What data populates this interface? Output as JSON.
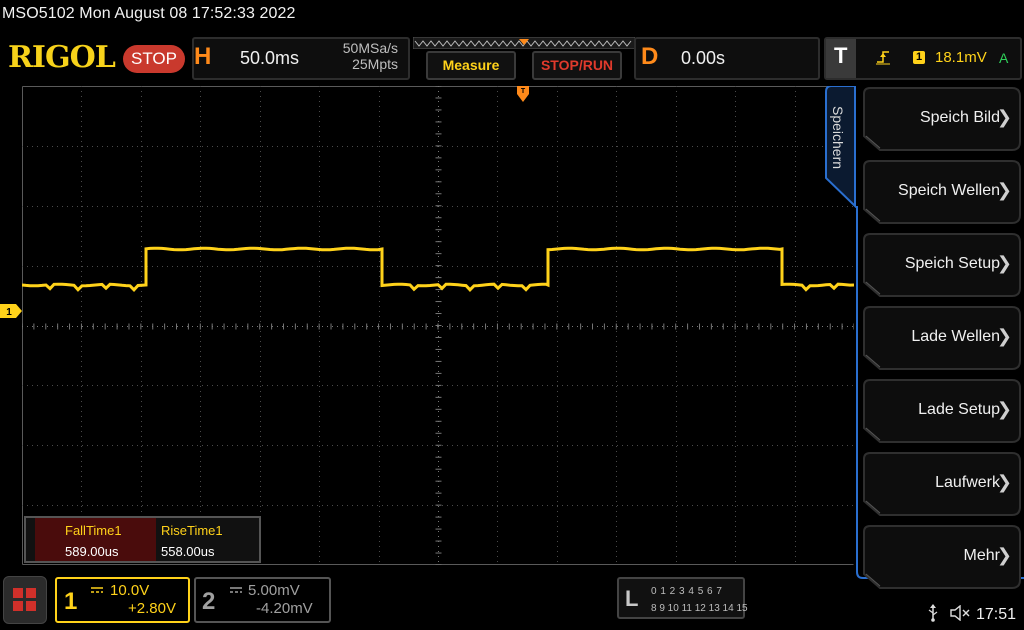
{
  "top_info": "MSO5102  Mon August 08 17:52:33 2022",
  "brand": {
    "logo_text": "RIGOL",
    "run_state": "STOP"
  },
  "horizontal": {
    "letter": "H",
    "timebase": "50.0ms",
    "sample_rate": "50MSa/s",
    "memory_depth": "25Mpts"
  },
  "toolbar": {
    "measure_label": "Measure",
    "stop_run_label": "STOP/RUN"
  },
  "delay": {
    "letter": "D",
    "value": "0.00s"
  },
  "trigger": {
    "letter": "T",
    "edge_icon": "rising-edge-icon",
    "source_channel": "1",
    "level": "18.1mV",
    "mode": "A"
  },
  "channel1_marker": "1",
  "measurements": [
    {
      "name": "FallTime1",
      "value": "589.00us"
    },
    {
      "name": "RiseTime1",
      "value": "558.00us"
    }
  ],
  "menu": {
    "tab_label": "Speichern",
    "items": [
      {
        "label": "Speich Bild"
      },
      {
        "label": "Speich Wellen"
      },
      {
        "label": "Speich Setup"
      },
      {
        "label": "Lade Wellen"
      },
      {
        "label": "Lade Setup"
      },
      {
        "label": "Laufwerk"
      },
      {
        "label": "Mehr"
      }
    ]
  },
  "channels": [
    {
      "number": "1",
      "scale": "10.0V",
      "offset": "+2.80V",
      "coupling_icon": "dc-coupling-icon",
      "active": true,
      "color": "#ffd21a"
    },
    {
      "number": "2",
      "scale": "5.00mV",
      "offset": "-4.20mV",
      "coupling_icon": "dc-coupling-icon",
      "active": false,
      "color": "#a0a0a0"
    }
  ],
  "logic_analyzer": {
    "letter": "L",
    "row1": "0 1 2 3  4 5 6 7",
    "row2": "8 9 10 11 12 13 14 15"
  },
  "status": {
    "clock": "17:51"
  },
  "colors": {
    "channel1": "#ffd21a",
    "accent_orange": "#ff8a1a",
    "stop_red": "#c9392d",
    "menu_blue": "#1f5fae"
  }
}
